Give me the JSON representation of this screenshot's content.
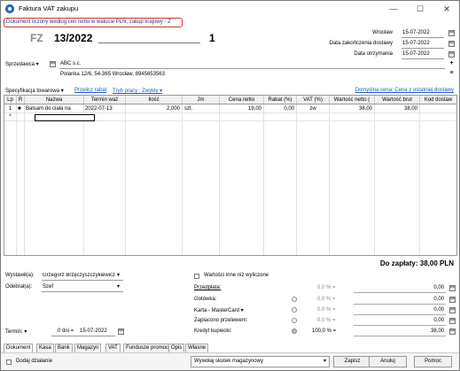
{
  "window": {
    "title": "Faktura VAT zakupu",
    "minimize": "—",
    "maximize": "☐",
    "close": "✕"
  },
  "banner": "Dokument liczony według cen netto w walucie PLN, zakup krajowy - Z",
  "header": {
    "prefix": "FZ",
    "number": "13/2022",
    "suffix": "1",
    "dates": [
      {
        "label": "Wrocław",
        "value": "15-07-2022"
      },
      {
        "label": "Data zakończenia dostawy",
        "value": "15-07-2022"
      },
      {
        "label": "Data otrzymania",
        "value": "15-07-2022"
      }
    ]
  },
  "seller": {
    "label": "Sprzedawca",
    "name": "ABC s.c.",
    "address": "Polanka 12/6, 54-365 Wrocław, 8945653563"
  },
  "toolbar": {
    "spec": "Specyfikacja towarowa",
    "recalc": "Przelicz rabat",
    "mode": "Tryb pracy : Zwykły",
    "default_price": "Domyślna cena: Cena z ostatniej dostawy"
  },
  "table": {
    "headers": [
      "Lp",
      "R",
      "Nazwa",
      "Termin waż",
      "Ilość",
      "Jm",
      "Cena netto",
      "Rabat (%)",
      "VAT (%)",
      "Wartość netto (",
      "Wartość brut",
      "Kod dostaw"
    ],
    "rows": [
      {
        "lp": "1",
        "r": "",
        "name": "Balsam do ciała na",
        "date": "2022-07-13",
        "qty": "2,000",
        "jm": "szt.",
        "price": "19,00",
        "discount": "0,00",
        "vat": "zw",
        "net": "38,00",
        "gross": "38,00",
        "code": ""
      }
    ],
    "new_row_marker": "*"
  },
  "total": "Do zapłaty: 38,00 PLN",
  "issued": {
    "label": "Wystawił(a):",
    "value": "Grzegorz Brzęczyszczykiewicz"
  },
  "received": {
    "label": "Odebrał(a):",
    "value": "Szef"
  },
  "other_values": "Wartości inne niż wyliczone",
  "payments": [
    {
      "label": "Przedpłata:",
      "pct": "0,0 % =",
      "amount": "0,00"
    },
    {
      "label": "Gotówka:",
      "pct": "0,0 % =",
      "amount": "0,00"
    },
    {
      "label": "Karta - MasterCard",
      "pct": "0,0 % =",
      "amount": "0,00"
    },
    {
      "label": "Zapłacono przelewem:",
      "pct": "0,0 % =",
      "amount": "0,00"
    },
    {
      "label": "Kredyt kupiecki:",
      "pct": "100,0 % =",
      "amount": "38,00"
    }
  ],
  "term": {
    "label": "Termin:",
    "days": "0 dni =",
    "date": "15-07-2022"
  },
  "tabs": [
    "Dokument",
    "Kasa",
    "Bank",
    "Magazyn",
    "VAT",
    "Fundusze promocji",
    "Opis",
    "Własne"
  ],
  "bottom": {
    "add_action": "Dodaj działanie",
    "warehouse": "Wywołaj skutek magazynowy",
    "save": "Zapisz",
    "cancel": "Anuluj",
    "help": "Pomoc"
  }
}
